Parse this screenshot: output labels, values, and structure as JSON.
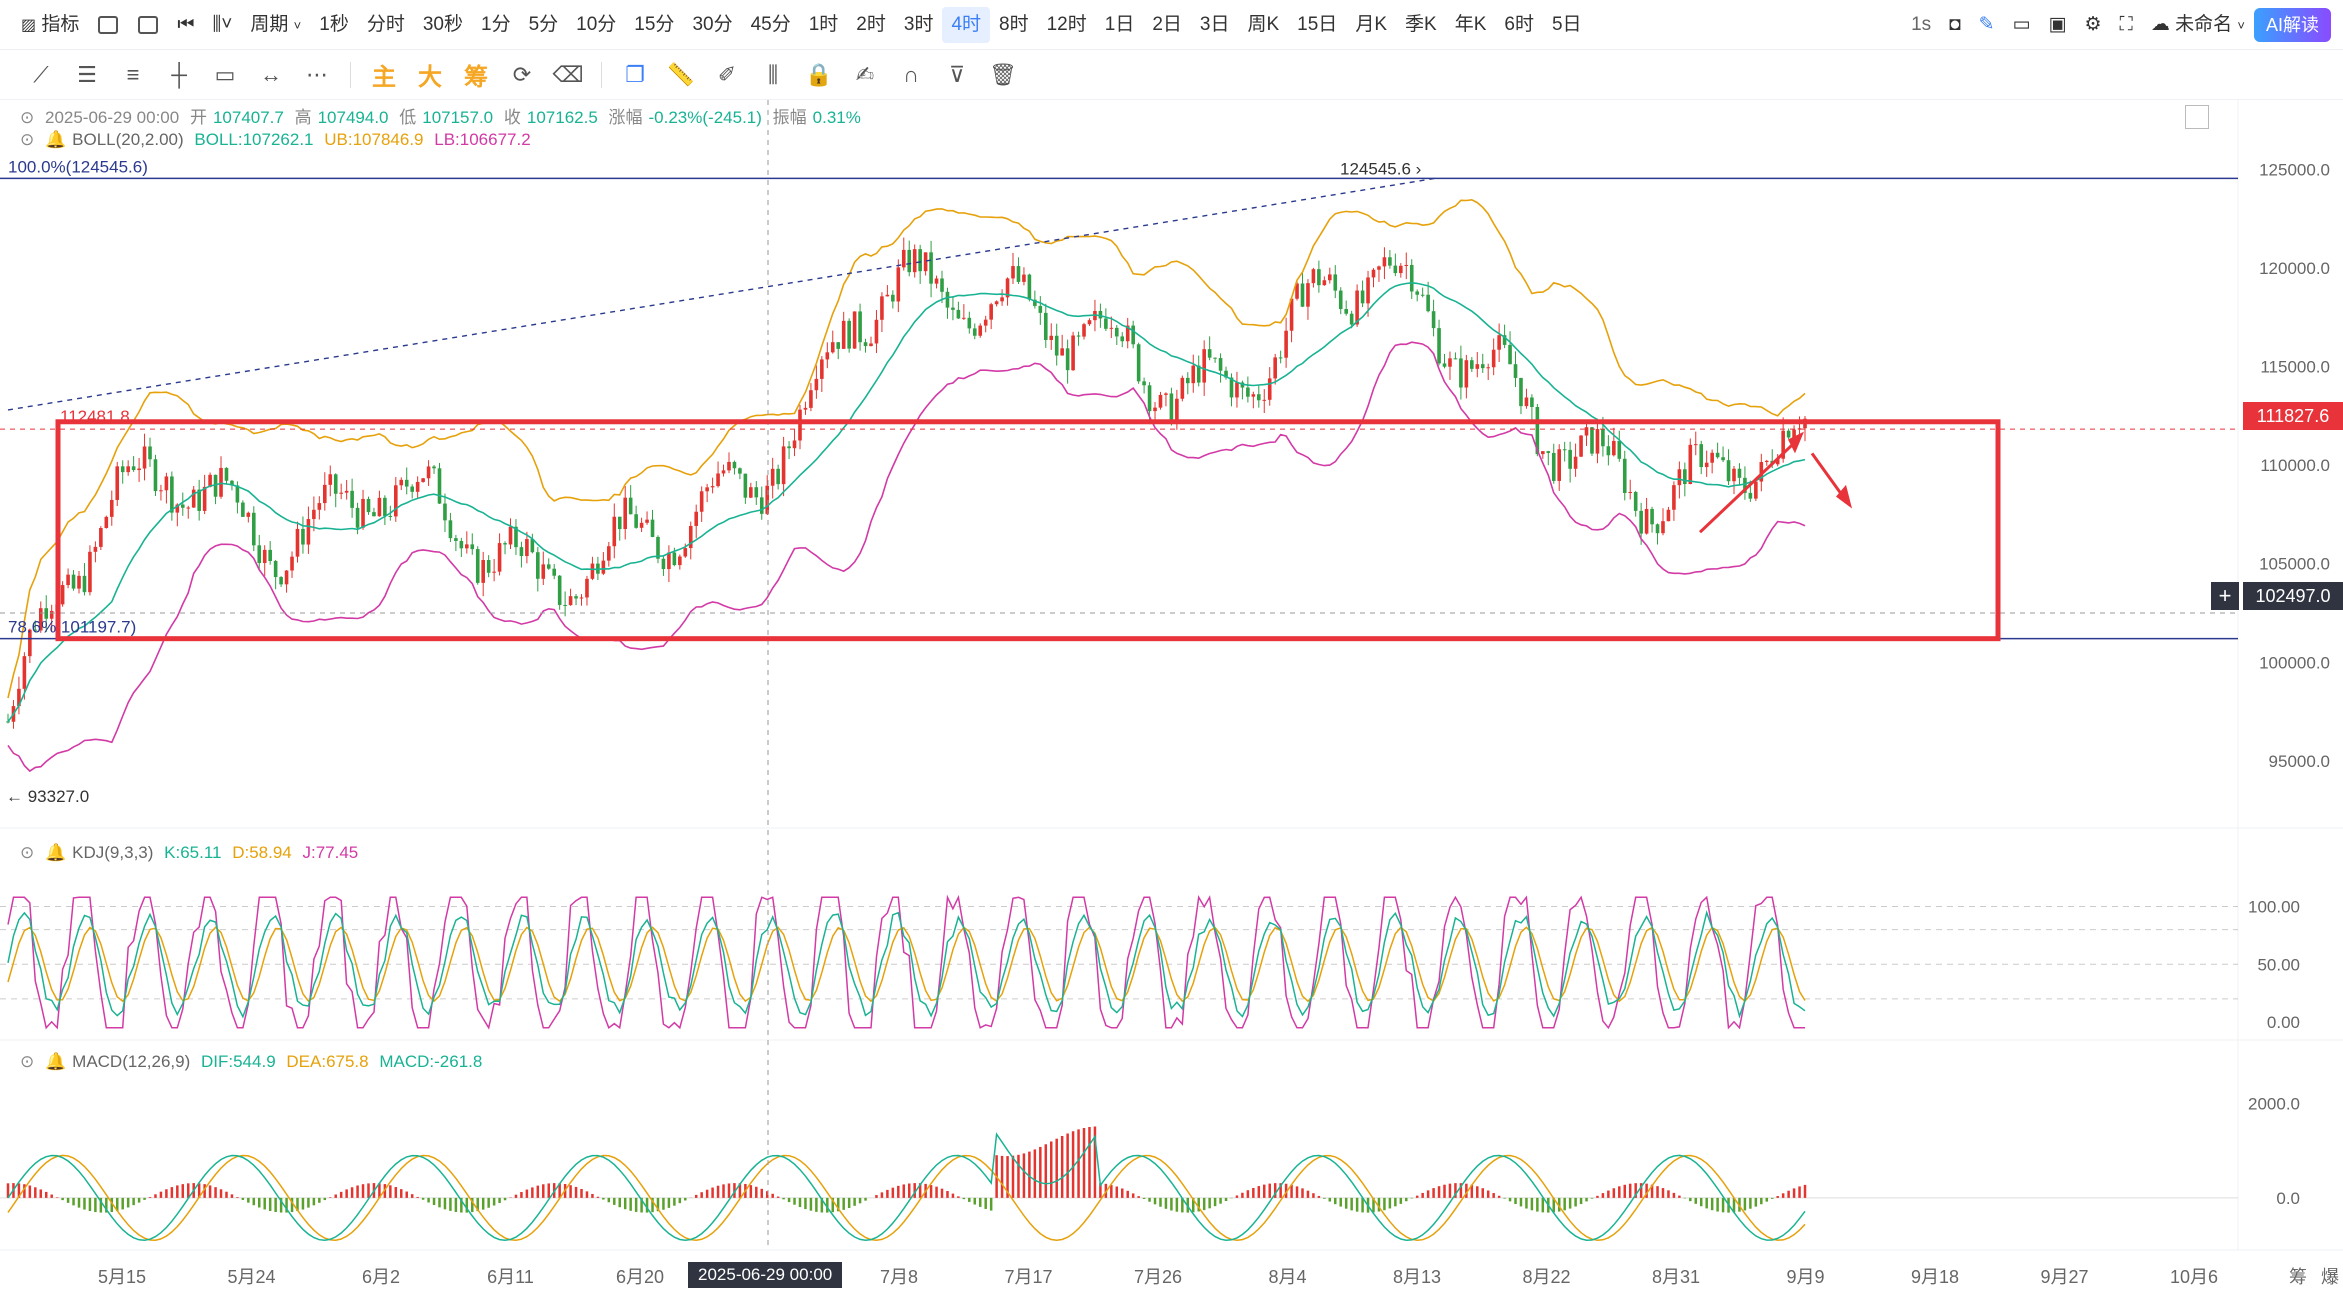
{
  "toolbar": {
    "indicator_label": "指标",
    "period_label": "周期",
    "periods": [
      "1秒",
      "分时",
      "30秒",
      "1分",
      "5分",
      "10分",
      "15分",
      "30分",
      "45分",
      "1时",
      "2时",
      "3时",
      "4时",
      "8时",
      "12时",
      "1日",
      "2日",
      "3日",
      "周K",
      "15日",
      "月K",
      "季K",
      "年K",
      "6时",
      "5日"
    ],
    "active_period": "4时",
    "interval_label": "1s",
    "cloud_label": "未命名",
    "ai_label": "AI解读"
  },
  "drawtools": {
    "main_label": "主",
    "big_label": "大",
    "chip_label": "筹"
  },
  "ohlc": {
    "date": "2025-06-29 00:00",
    "open_label": "开",
    "open": "107407.7",
    "high_label": "高",
    "high": "107494.0",
    "low_label": "低",
    "low": "107157.0",
    "close_label": "收",
    "close": "107162.5",
    "change_label": "涨幅",
    "change": "-0.23%(-245.1)",
    "amp_label": "振幅",
    "amp": "0.31%"
  },
  "boll": {
    "name": "BOLL(20,2.00)",
    "mid": "BOLL:107262.1",
    "ub": "UB:107846.9",
    "lb": "LB:106677.2"
  },
  "kdj": {
    "name": "KDJ(9,3,3)",
    "k": "K:65.11",
    "d": "D:58.94",
    "j": "J:77.45"
  },
  "macd": {
    "name": "MACD(12,26,9)",
    "dif": "DIF:544.9",
    "dea": "DEA:675.8",
    "macd": "MACD:-261.8"
  },
  "fib": {
    "top": "100.0%(124545.6)",
    "bottom": "78.6%  101197.7)",
    "high_marker": "124545.6",
    "low_marker": "93327.0",
    "level_112": "112481.8"
  },
  "price_axis": {
    "ticks": [
      "125000.0",
      "120000.0",
      "115000.0",
      "110000.0",
      "105000.0",
      "100000.0",
      "95000.0"
    ],
    "current_price": "111827.6",
    "crosshair_price": "102497.0"
  },
  "kdj_axis": [
    "100.00",
    "50.00",
    "0.00"
  ],
  "macd_axis": [
    "2000.0",
    "0.0"
  ],
  "time_axis": {
    "labels": [
      "5月15",
      "5月24",
      "6月2",
      "6月11",
      "6月20",
      "7月8",
      "7月17",
      "7月26",
      "8月4",
      "8月13",
      "8月22",
      "8月31",
      "9月9",
      "9月18",
      "9月27",
      "10月6"
    ],
    "crosshair_time": "2025-06-29 00:00",
    "corner_labels": [
      "筹",
      "爆"
    ]
  },
  "colors": {
    "boll_mid": "#19b394",
    "boll_ub": "#e6a10b",
    "boll_lb": "#d23aa6",
    "up": "#e3342f",
    "down": "#2f9e44",
    "accent": "#3b7ff6",
    "box": "#e8333a",
    "fib_line": "#2b3a8f"
  },
  "chart_data": {
    "type": "candlestick",
    "symbol_interval": "4时",
    "x_range": [
      "5月10",
      "9月9"
    ],
    "price_ylim": [
      92000,
      127000
    ],
    "boll_mid_approx": [
      97000,
      104000,
      108000,
      110000,
      108000,
      106000,
      107000,
      109000,
      108000,
      106000,
      104000,
      105000,
      106500,
      107500,
      109000,
      112000,
      118000,
      119000,
      118500,
      118000,
      117000,
      116000,
      114000,
      113500,
      116000,
      119000,
      120000,
      117000,
      115000,
      112000,
      110000,
      108500,
      109000,
      110500,
      111000
    ],
    "kdj_ylim": [
      0,
      110
    ],
    "macd_ylim": [
      -1000,
      2500
    ]
  }
}
